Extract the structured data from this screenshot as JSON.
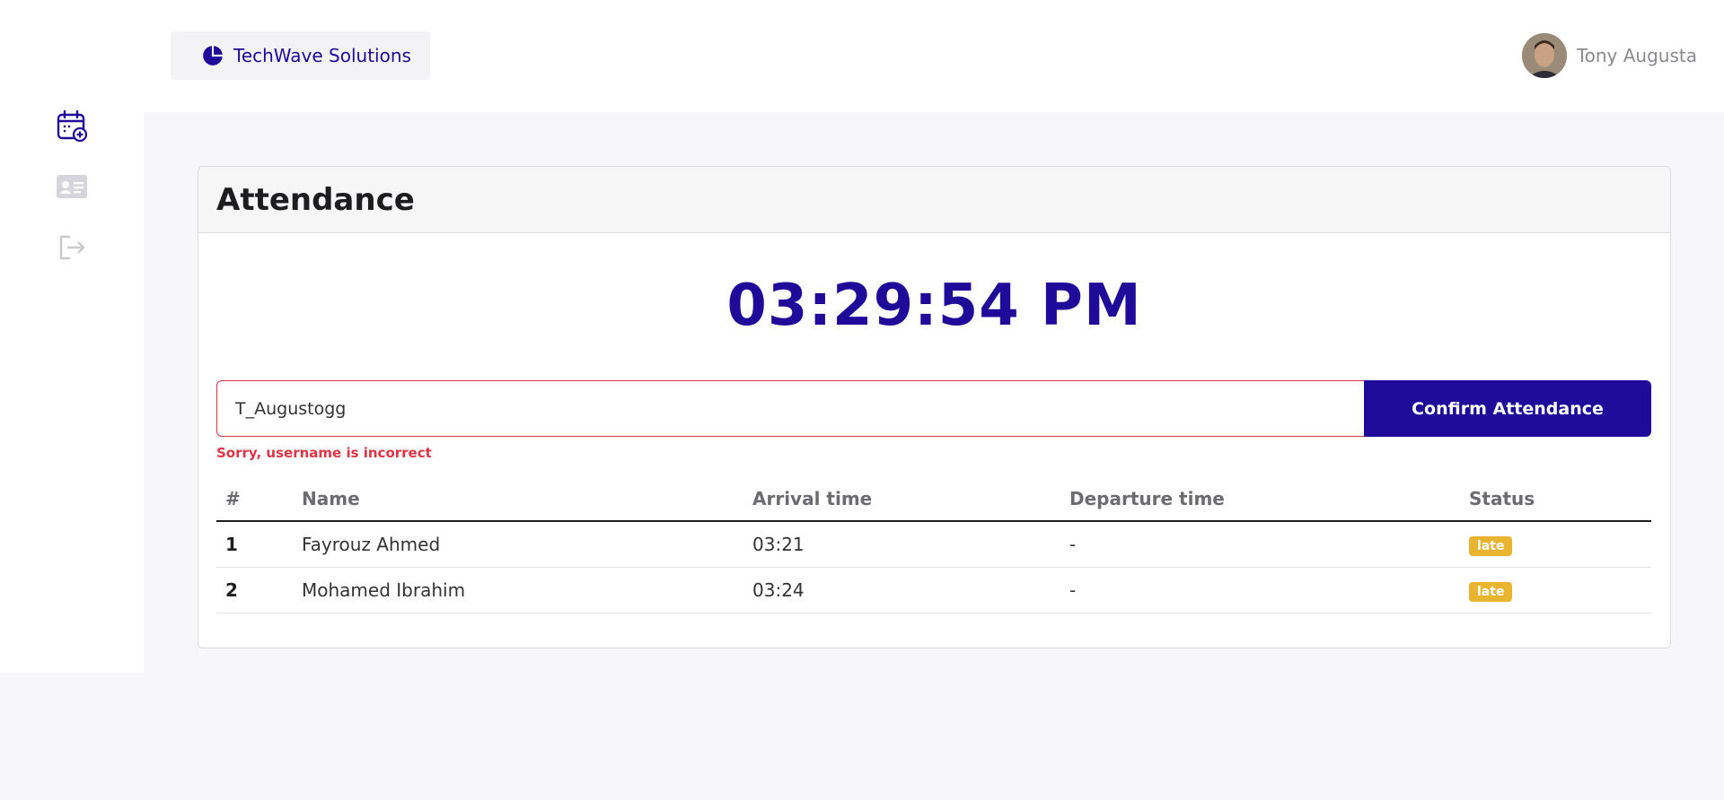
{
  "header": {
    "company_name": "TechWave Solutions",
    "company_icon": "pie-chart-icon",
    "user_name": "Tony Augusta"
  },
  "sidebar": {
    "items": [
      {
        "icon": "calendar-add-icon",
        "active": true
      },
      {
        "icon": "id-card-icon",
        "active": false
      },
      {
        "icon": "logout-icon",
        "active": false
      }
    ]
  },
  "card": {
    "title": "Attendance",
    "clock": "03:29:54 PM",
    "input_value": "T_Augustogg",
    "confirm_label": "Confirm Attendance",
    "error_message": "Sorry, username is incorrect"
  },
  "table": {
    "headers": [
      "#",
      "Name",
      "Arrival time",
      "Departure time",
      "Status"
    ],
    "rows": [
      {
        "index": "1",
        "name": "Fayrouz Ahmed",
        "arrival": "03:21",
        "departure": "-",
        "status": "late"
      },
      {
        "index": "2",
        "name": "Mohamed Ibrahim",
        "arrival": "03:24",
        "departure": "-",
        "status": "late"
      }
    ]
  },
  "colors": {
    "primary": "#1f0a99",
    "error": "#dc3545",
    "badge_late": "#e9b42f"
  }
}
